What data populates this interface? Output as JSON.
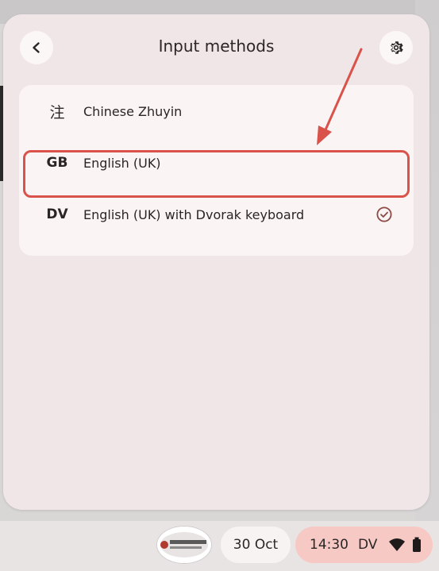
{
  "panel": {
    "title": "Input methods"
  },
  "input_methods": [
    {
      "code": "注",
      "label": "Chinese Zhuyin",
      "selected": false
    },
    {
      "code": "GB",
      "label": "English (UK)",
      "selected": false
    },
    {
      "code": "DV",
      "label": "English (UK) with Dvorak keyboard",
      "selected": true
    }
  ],
  "shelf": {
    "date": "30 Oct",
    "time": "14:30",
    "ime_indicator": "DV"
  },
  "icons": {
    "back": "arrow-left-icon",
    "settings": "gear-icon",
    "check": "check-circle-icon",
    "wifi": "wifi-icon",
    "battery": "battery-icon"
  },
  "colors": {
    "accent_annotation": "#d9534b",
    "panel_bg": "#f1e6e7",
    "status_pill_bg": "#f7c9c5"
  }
}
